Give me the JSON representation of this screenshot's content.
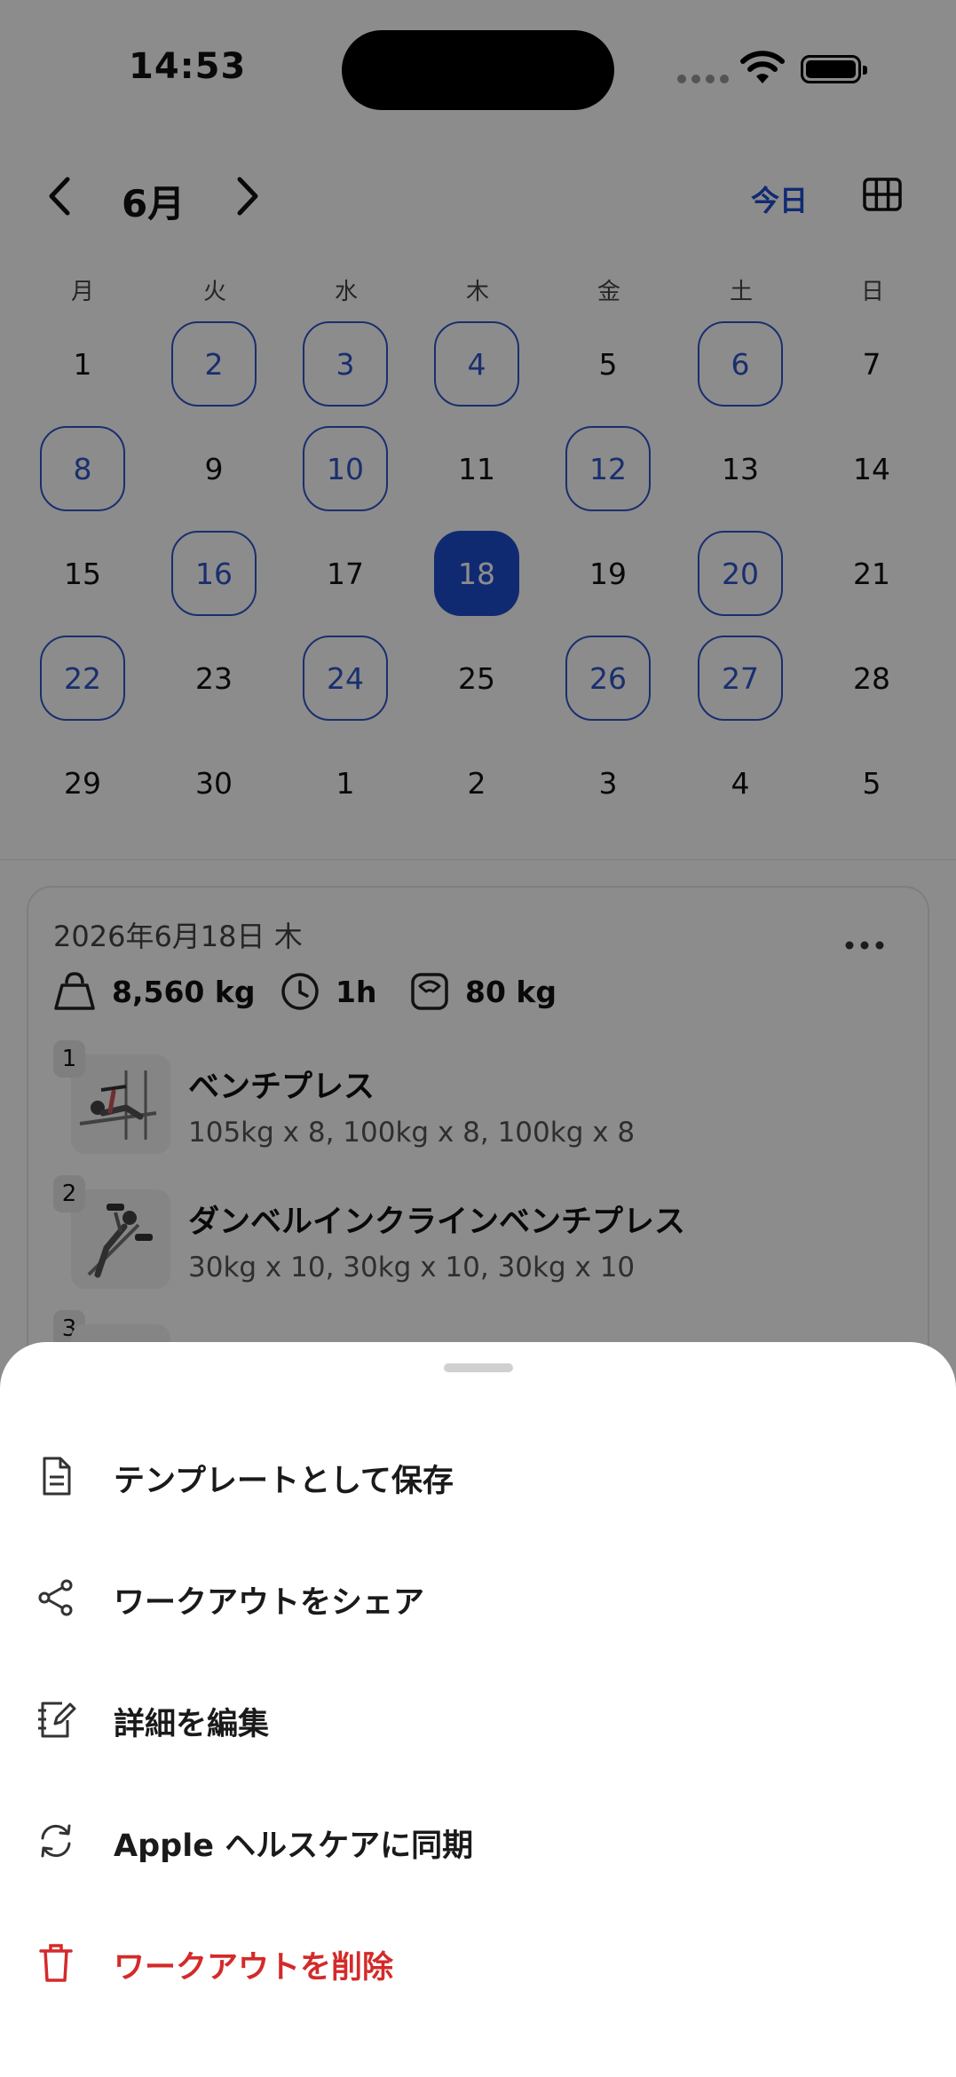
{
  "status_bar": {
    "time": "14:53"
  },
  "calendar": {
    "month_label": "6月",
    "today_label": "今日",
    "weekdays": [
      "月",
      "火",
      "水",
      "木",
      "金",
      "土",
      "日"
    ],
    "weeks": [
      [
        "1",
        "2",
        "3",
        "4",
        "5",
        "6",
        "7"
      ],
      [
        "8",
        "9",
        "10",
        "11",
        "12",
        "13",
        "14"
      ],
      [
        "15",
        "16",
        "17",
        "18",
        "19",
        "20",
        "21"
      ],
      [
        "22",
        "23",
        "24",
        "25",
        "26",
        "27",
        "28"
      ],
      [
        "29",
        "30",
        "1",
        "2",
        "3",
        "4",
        "5"
      ]
    ],
    "workout_days": [
      "2",
      "3",
      "4",
      "6",
      "8",
      "10",
      "12",
      "16",
      "20",
      "22",
      "24",
      "26",
      "27"
    ],
    "selected_day": "18",
    "accent_color": "#1e4ed0"
  },
  "workout": {
    "date": "2026年6月18日 木",
    "stats": {
      "volume": "8,560 kg",
      "duration": "1h",
      "body_weight": "80 kg"
    },
    "exercises": [
      {
        "num": "1",
        "name": "ベンチプレス",
        "sets": "105kg x 8, 100kg x 8, 100kg x 8"
      },
      {
        "num": "2",
        "name": "ダンベルインクラインベンチプレス",
        "sets": "30kg x 10, 30kg x 10, 30kg x 10"
      },
      {
        "num": "3"
      }
    ]
  },
  "sheet": {
    "items": [
      {
        "label": "テンプレートとして保存",
        "icon": "document-icon"
      },
      {
        "label": "ワークアウトをシェア",
        "icon": "share-icon"
      },
      {
        "label": "詳細を編集",
        "icon": "edit-notebook-icon"
      },
      {
        "label": "Apple ヘルスケアに同期",
        "icon": "sync-icon"
      },
      {
        "label": "ワークアウトを削除",
        "icon": "trash-icon",
        "danger_color": "#d42a2a"
      }
    ]
  }
}
